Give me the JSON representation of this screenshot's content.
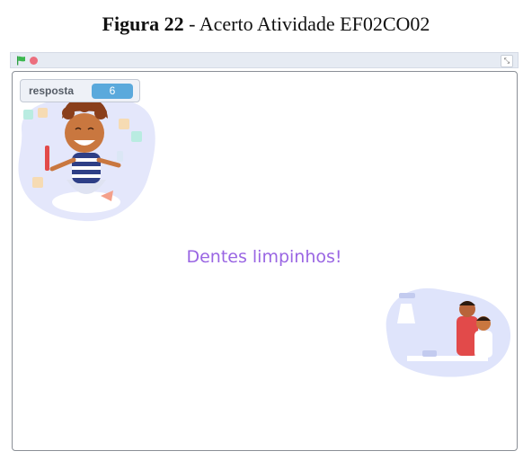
{
  "caption": {
    "prefix": "Figura 22",
    "separator": " - ",
    "text": "Acerto Atividade EF02CO02"
  },
  "toolbar": {
    "flag_icon": "green-flag-icon",
    "stop_icon": "stop-icon",
    "fullscreen_icon": "fullscreen-icon",
    "fullscreen_glyph": "⤡"
  },
  "monitor": {
    "label": "resposta",
    "value": "6"
  },
  "stage": {
    "message": "Dentes limpinhos!"
  },
  "colors": {
    "message": "#9a66e3",
    "monitor_value": "#5aa9dc",
    "flag": "#2f9e44",
    "stop": "#ec6f7e"
  }
}
